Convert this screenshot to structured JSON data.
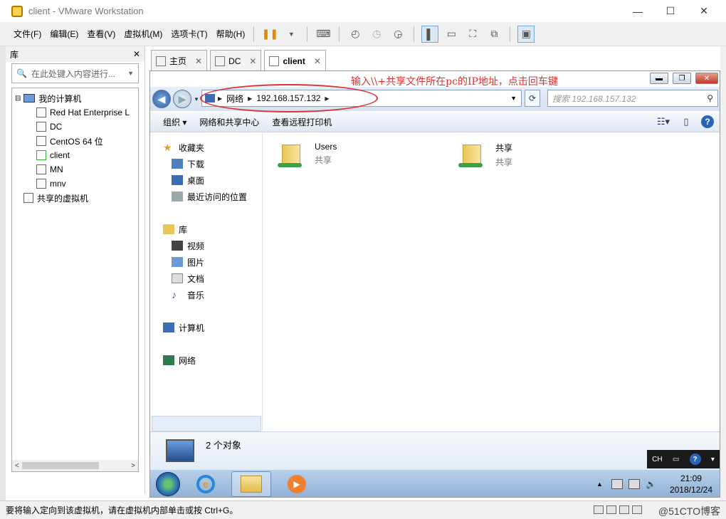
{
  "window": {
    "title": "client - VMware Workstation",
    "controls": {
      "minimize": "—",
      "maximize": "☐",
      "close": "✕"
    }
  },
  "menubar": {
    "items": [
      "文件(F)",
      "编辑(E)",
      "查看(V)",
      "虚拟机(M)",
      "选项卡(T)",
      "帮助(H)"
    ]
  },
  "library": {
    "title": "库",
    "close": "✕",
    "search_placeholder": "在此处键入内容进行...",
    "tree": {
      "root": "我的计算机",
      "vms": [
        "Red Hat Enterprise L",
        "DC",
        "CentOS 64 位",
        "client",
        "MN",
        "mnv"
      ],
      "shared": "共享的虚拟机"
    },
    "scroll_left": "<",
    "scroll_right": ">"
  },
  "tabs": [
    {
      "label": "主页",
      "close": "✕"
    },
    {
      "label": "DC",
      "close": "✕"
    },
    {
      "label": "client",
      "close": "✕"
    }
  ],
  "guest": {
    "annotation": "输入\\\\+共享文件所在pc的IP地址，点击回车键",
    "address": {
      "segments": [
        "网络",
        "192.168.157.132"
      ]
    },
    "search_placeholder": "搜索 192.168.157.132",
    "commands": [
      "组织 ▾",
      "网络和共享中心",
      "查看远程打印机"
    ],
    "nav": {
      "favorites": {
        "label": "收藏夹",
        "items": [
          "下载",
          "桌面",
          "最近访问的位置"
        ]
      },
      "libraries": {
        "label": "库",
        "items": [
          "视频",
          "图片",
          "文档",
          "音乐"
        ]
      },
      "computer": "计算机",
      "network": "网络"
    },
    "shares": [
      {
        "name": "Users",
        "sub": "共享"
      },
      {
        "name": "共享",
        "sub": "共享"
      }
    ],
    "details": {
      "count": "2 个对象"
    },
    "langbar": {
      "lang": "CH"
    },
    "clock": {
      "time": "21:09",
      "date": "2018/12/24"
    }
  },
  "statusbar": {
    "message": "要将输入定向到该虚拟机，请在虚拟机内部单击或按 Ctrl+G。",
    "watermark": "@51CTO博客"
  }
}
